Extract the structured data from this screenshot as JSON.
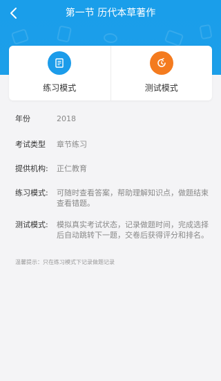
{
  "header": {
    "title": "第一节 历代本草著作",
    "back_icon": "chevron-left-icon"
  },
  "modes": [
    {
      "label": "练习模式",
      "icon": "notebook-icon",
      "color": "#1c9cea"
    },
    {
      "label": "测试模式",
      "icon": "timer-icon",
      "color": "#f47b1f"
    }
  ],
  "info": {
    "year_label": "年份",
    "year_value": "2018",
    "exam_type_label": "考试类型",
    "exam_type_value": "章节练习",
    "provider_label": "提供机构:",
    "provider_value": "正仁教育",
    "practice_label": "练习模式:",
    "practice_value": "可随时查看答案，帮助理解知识点，做题结束查看错题。",
    "test_label": "测试模式:",
    "test_value": "模拟真实考试状态，记录做题时间，完成选择后自动跳转下一题，交卷后获得评分和排名。"
  },
  "tip": "温馨提示：只在练习模式下记录做题记录",
  "colors": {
    "header_bg": "#1a9eea",
    "page_bg": "#f4f4f6"
  }
}
